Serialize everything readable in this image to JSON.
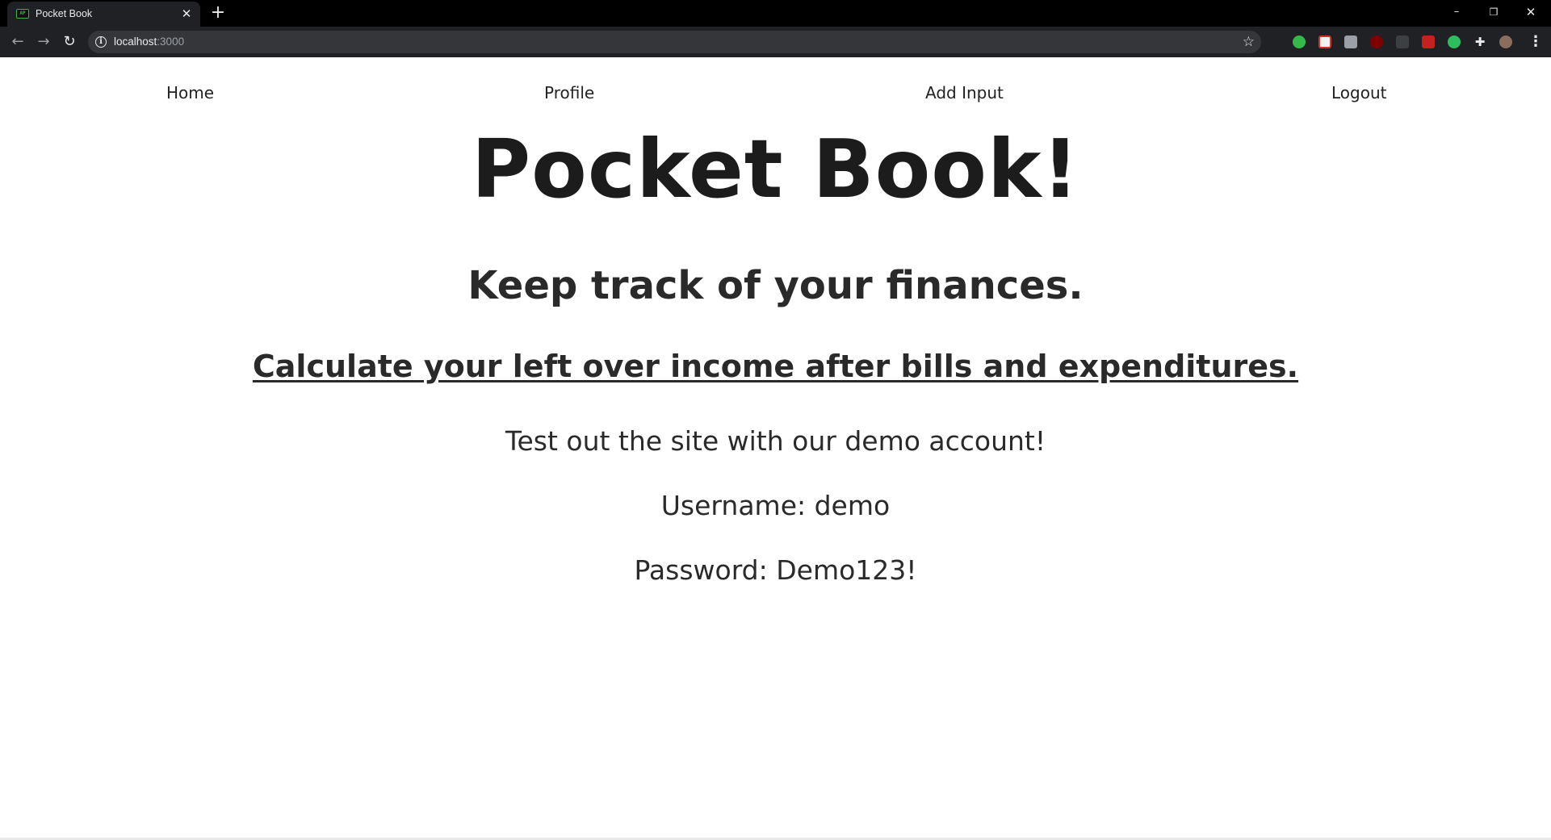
{
  "browser": {
    "tab_title": "Pocket Book",
    "tab_close_glyph": "✕",
    "new_tab_glyph": "+",
    "url_host": "localhost",
    "url_port": ":3000",
    "window_controls": {
      "minimize": "–",
      "restore": "❐",
      "close": "✕"
    },
    "extensions": [
      {
        "icon": "green-circle-extension-icon",
        "color": "#35b94a"
      },
      {
        "icon": "gmail-extension-icon",
        "color": "#d93025"
      },
      {
        "icon": "screen-extension-icon",
        "color": "#9aa0a6"
      },
      {
        "icon": "ublock-extension-icon",
        "color": "#800000"
      },
      {
        "icon": "filter-extension-icon",
        "color": "#5f6368"
      },
      {
        "icon": "red-tool-extension-icon",
        "color": "#c5221f"
      },
      {
        "icon": "evernote-extension-icon",
        "color": "#2dbe60"
      },
      {
        "icon": "puzzle-extension-icon",
        "color": "#e8eaed"
      },
      {
        "icon": "profile-avatar-icon",
        "color": "#8a6d5a"
      }
    ]
  },
  "nav": {
    "home": "Home",
    "profile": "Profile",
    "add_input": "Add Input",
    "logout": "Logout"
  },
  "hero": {
    "title": "Pocket Book!",
    "subtitle": "Keep track of your finances.",
    "tagline": "Calculate your left over income after bills and expenditures."
  },
  "demo": {
    "intro": "Test out the site with our demo account!",
    "username": "Username: demo",
    "password": "Password: Demo123!"
  },
  "colors": {
    "tabbar": "#000000",
    "toolbar": "#202124",
    "omnibox": "#35363a",
    "text": "#2a2a2a"
  }
}
